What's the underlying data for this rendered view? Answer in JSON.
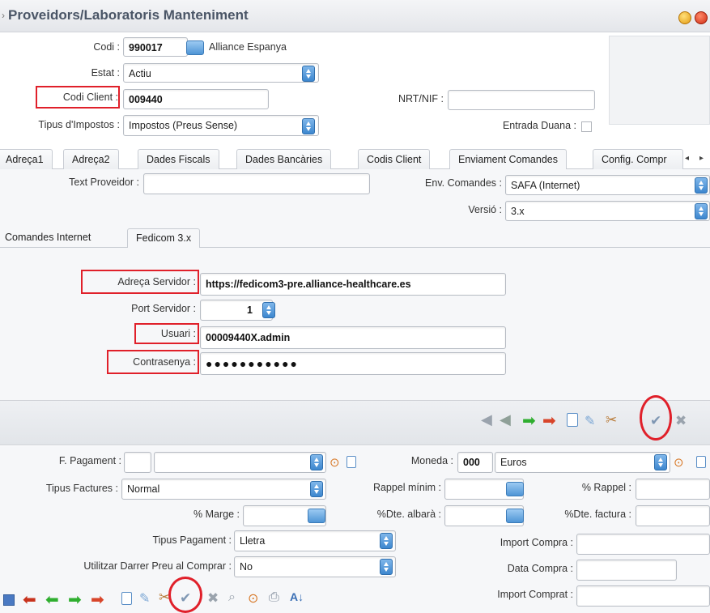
{
  "window": {
    "title": "Proveidors/Laboratoris Manteniment"
  },
  "header": {
    "codi_label": "Codi :",
    "codi_value": "990017",
    "codi_name": "Alliance Espanya",
    "estat_label": "Estat :",
    "estat_value": "Actiu",
    "codi_client_label": "Codi Client :",
    "codi_client_value": "009440",
    "nrt_label": "NRT/NIF :",
    "nrt_value": "",
    "tipus_impostos_label": "Tipus d'Impostos :",
    "tipus_impostos_value": "Impostos (Preus Sense)",
    "entrada_duana_label": "Entrada Duana :"
  },
  "main_tabs": [
    {
      "label": "Adreça1"
    },
    {
      "label": "Adreça2"
    },
    {
      "label": "Dades Fiscals"
    },
    {
      "label": "Dades Bancàries"
    },
    {
      "label": "Codis Client"
    },
    {
      "label": "Enviament Comandes"
    },
    {
      "label": "Config. Compr"
    }
  ],
  "enviament": {
    "text_proveidor_label": "Text Proveidor :",
    "text_proveidor_value": "",
    "env_comandes_label": "Env. Comandes :",
    "env_comandes_value": "SAFA (Internet)",
    "versio_label": "Versió :",
    "versio_value": "3.x"
  },
  "sub_tabs": [
    {
      "label": "Comandes Internet"
    },
    {
      "label": "Fedicom 3.x"
    }
  ],
  "fedicom": {
    "adreca_label": "Adreça Servidor :",
    "adreca_value": "https://fedicom3-pre.alliance-healthcare.es",
    "port_label": "Port Servidor :",
    "port_value": "1",
    "usuari_label": "Usuari :",
    "usuari_value": "00009440X.admin",
    "contrasenya_label": "Contrasenya :",
    "contrasenya_value": "●●●●●●●●●●●"
  },
  "bottom": {
    "f_pagament_label": "F. Pagament :",
    "f_pagament_code": "",
    "f_pagament_value": "",
    "moneda_label": "Moneda :",
    "moneda_code": "000",
    "moneda_value": "Euros",
    "tipus_factures_label": "Tipus Factures :",
    "tipus_factures_value": "Normal",
    "rappel_minim_label": "Rappel mínim :",
    "pct_rappel_label": "% Rappel :",
    "pct_marge_label": "% Marge :",
    "dte_albara_label": "%Dte. albarà :",
    "dte_factura_label": "%Dte. factura :",
    "tipus_pagament_label": "Tipus Pagament :",
    "tipus_pagament_value": "Lletra",
    "darrer_preu_label": "Utilitzar Darrer Preu al Comprar :",
    "darrer_preu_value": "No",
    "import_compra_label": "Import Compra :",
    "data_compra_label": "Data Compra :",
    "import_comprat_label": "Import Comprat :"
  },
  "colors": {
    "accent": "#3d87cf",
    "highlight": "#e0202a",
    "title": "#4a5566"
  }
}
